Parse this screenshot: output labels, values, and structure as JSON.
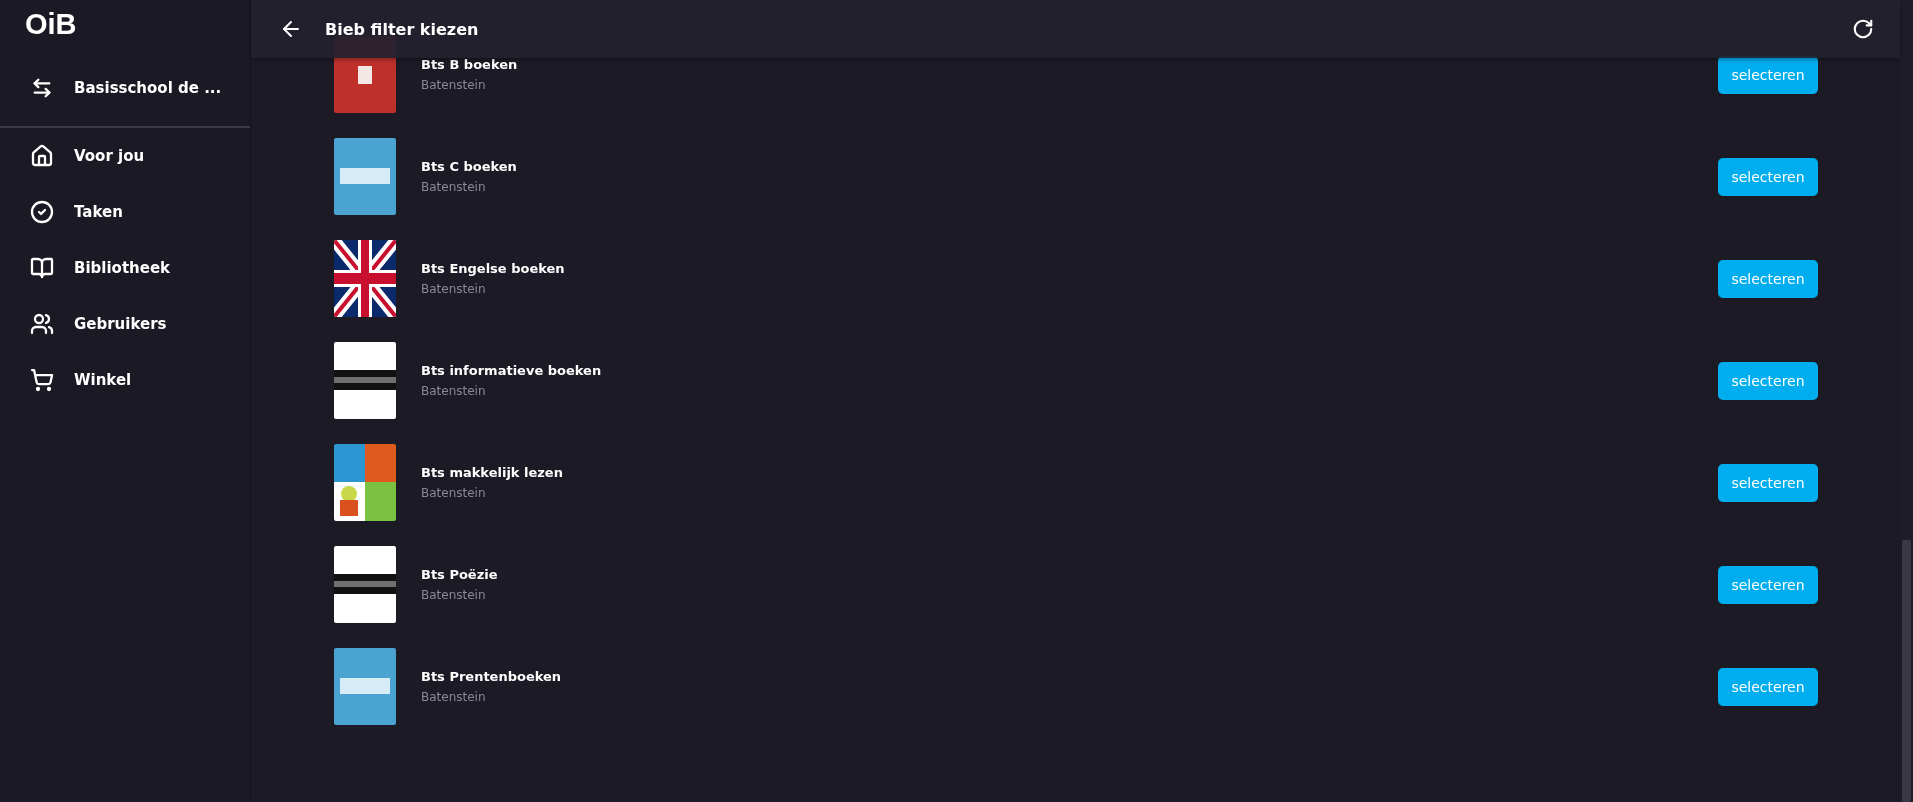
{
  "sidebar": {
    "logo": "OiB",
    "school": {
      "label": "Basisschool de ..."
    },
    "items": [
      {
        "label": "Voor jou"
      },
      {
        "label": "Taken"
      },
      {
        "label": "Bibliotheek"
      },
      {
        "label": "Gebruikers"
      },
      {
        "label": "Winkel"
      }
    ]
  },
  "header": {
    "title": "Bieb filter kiezen"
  },
  "filters": [
    {
      "title": "Bts B boeken",
      "subtitle": "Batenstein",
      "button": "selecteren"
    },
    {
      "title": "Bts C boeken",
      "subtitle": "Batenstein",
      "button": "selecteren"
    },
    {
      "title": "Bts Engelse boeken",
      "subtitle": "Batenstein",
      "button": "selecteren"
    },
    {
      "title": "Bts informatieve boeken",
      "subtitle": "Batenstein",
      "button": "selecteren"
    },
    {
      "title": "Bts makkelijk lezen",
      "subtitle": "Batenstein",
      "button": "selecteren"
    },
    {
      "title": "Bts Poëzie",
      "subtitle": "Batenstein",
      "button": "selecteren"
    },
    {
      "title": "Bts Prentenboeken",
      "subtitle": "Batenstein",
      "button": "selecteren"
    }
  ]
}
